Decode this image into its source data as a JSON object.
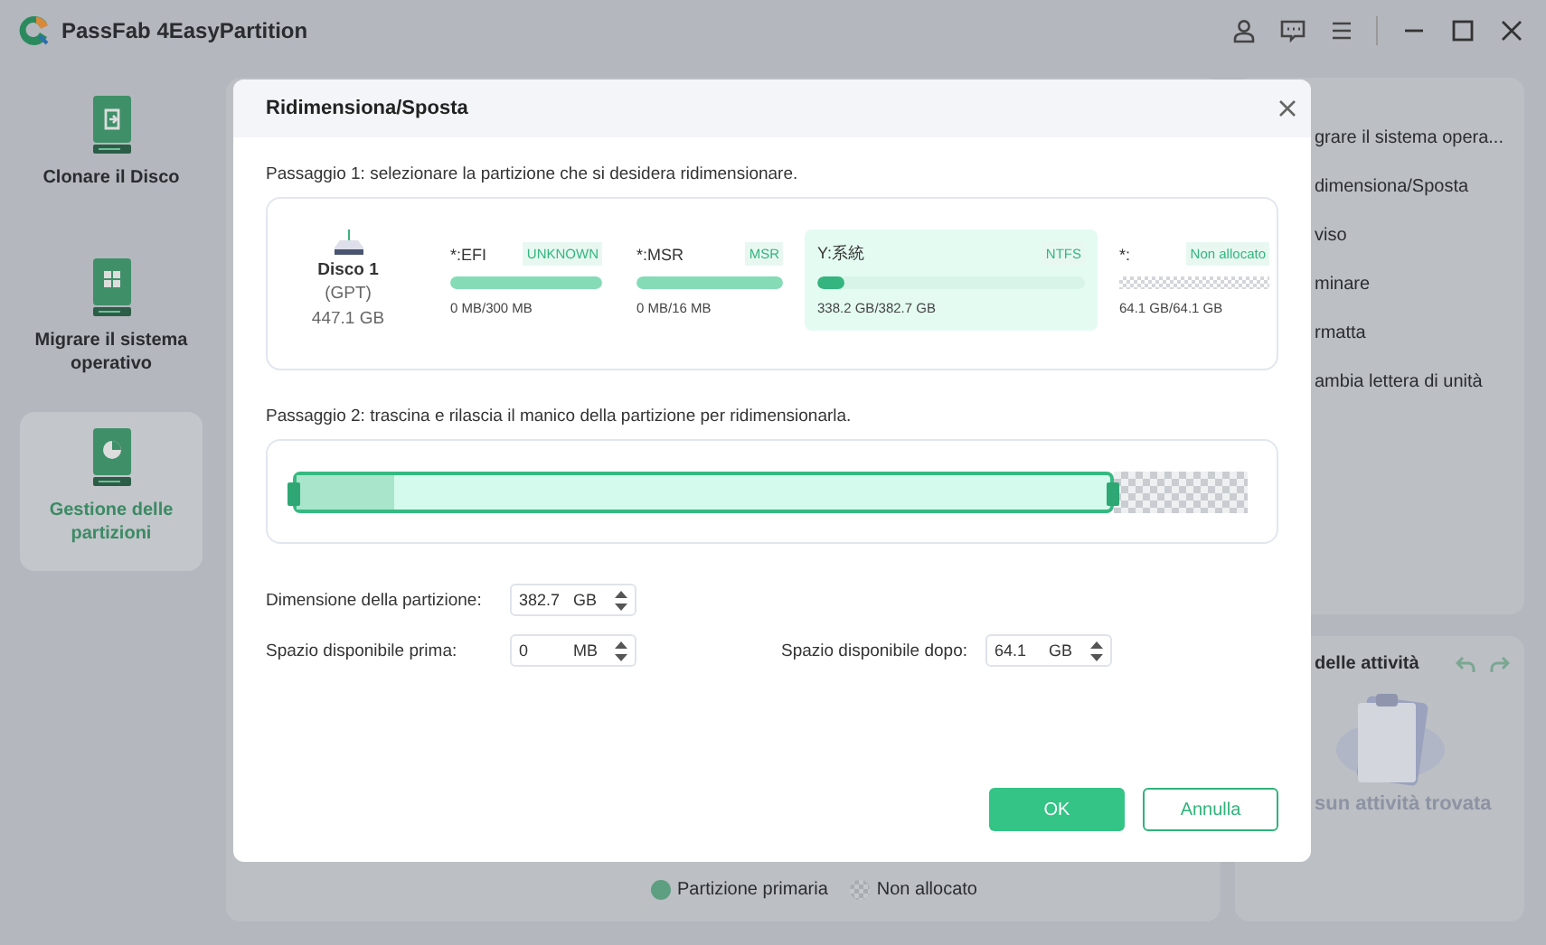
{
  "app": {
    "title": "PassFab 4EasyPartition"
  },
  "sidebar": [
    {
      "label": "Clonare il Disco",
      "kind": "clone",
      "selected": false
    },
    {
      "label": "Migrare il sistema operativo",
      "kind": "grid",
      "selected": false
    },
    {
      "label": "Gestione delle partizioni",
      "kind": "pie",
      "selected": true
    }
  ],
  "operations_menu": [
    "grare il sistema opera...",
    "dimensiona/Sposta",
    "viso",
    "minare",
    "rmatta",
    "ambia lettera di unità"
  ],
  "task_panel": {
    "title": "delle attività",
    "empty_text": "sun attività trovata"
  },
  "legend": [
    {
      "kind": "primary",
      "label": "Partizione primaria"
    },
    {
      "kind": "unallocated",
      "label": "Non allocato"
    }
  ],
  "dialog": {
    "title": "Ridimensiona/Sposta",
    "step1": "Passaggio 1: selezionare la partizione che si desidera ridimensionare.",
    "disk": {
      "name": "Disco 1",
      "style": "(GPT)",
      "size": "447.1 GB"
    },
    "partitions": [
      {
        "kind": "partition",
        "name": "*:EFI",
        "type": "UNKNOWN",
        "usage": "0 MB/300 MB",
        "level": 1,
        "selected": false
      },
      {
        "kind": "partition",
        "name": "*:MSR",
        "type": "MSR",
        "usage": "0 MB/16 MB",
        "level": 1,
        "selected": false
      },
      {
        "kind": "partition",
        "name": "Y:系統",
        "type": "NTFS",
        "usage": "338.2 GB/382.7 GB",
        "level": 0.1,
        "selected": true
      },
      {
        "kind": "unallocated",
        "name": "*:",
        "type": "Non allocato",
        "usage": "64.1 GB/64.1 GB",
        "selected": false
      }
    ],
    "step2": "Passaggio 2: trascina e rilascia il manico della partizione per ridimensionarla.",
    "resize_bar": {
      "level": 0.12
    },
    "fields": [
      {
        "label": "Dimensione della partizione:",
        "value": "382.7",
        "unit": "GB"
      },
      {
        "label": "Spazio disponibile prima:",
        "value": "0",
        "unit": "MB"
      },
      {
        "label": "Spazio disponibile dopo:",
        "value": "64.1",
        "unit": "GB"
      }
    ],
    "buttons": [
      {
        "kind": "primary",
        "label": "OK"
      },
      {
        "kind": "secondary",
        "label": "Annulla"
      }
    ]
  }
}
